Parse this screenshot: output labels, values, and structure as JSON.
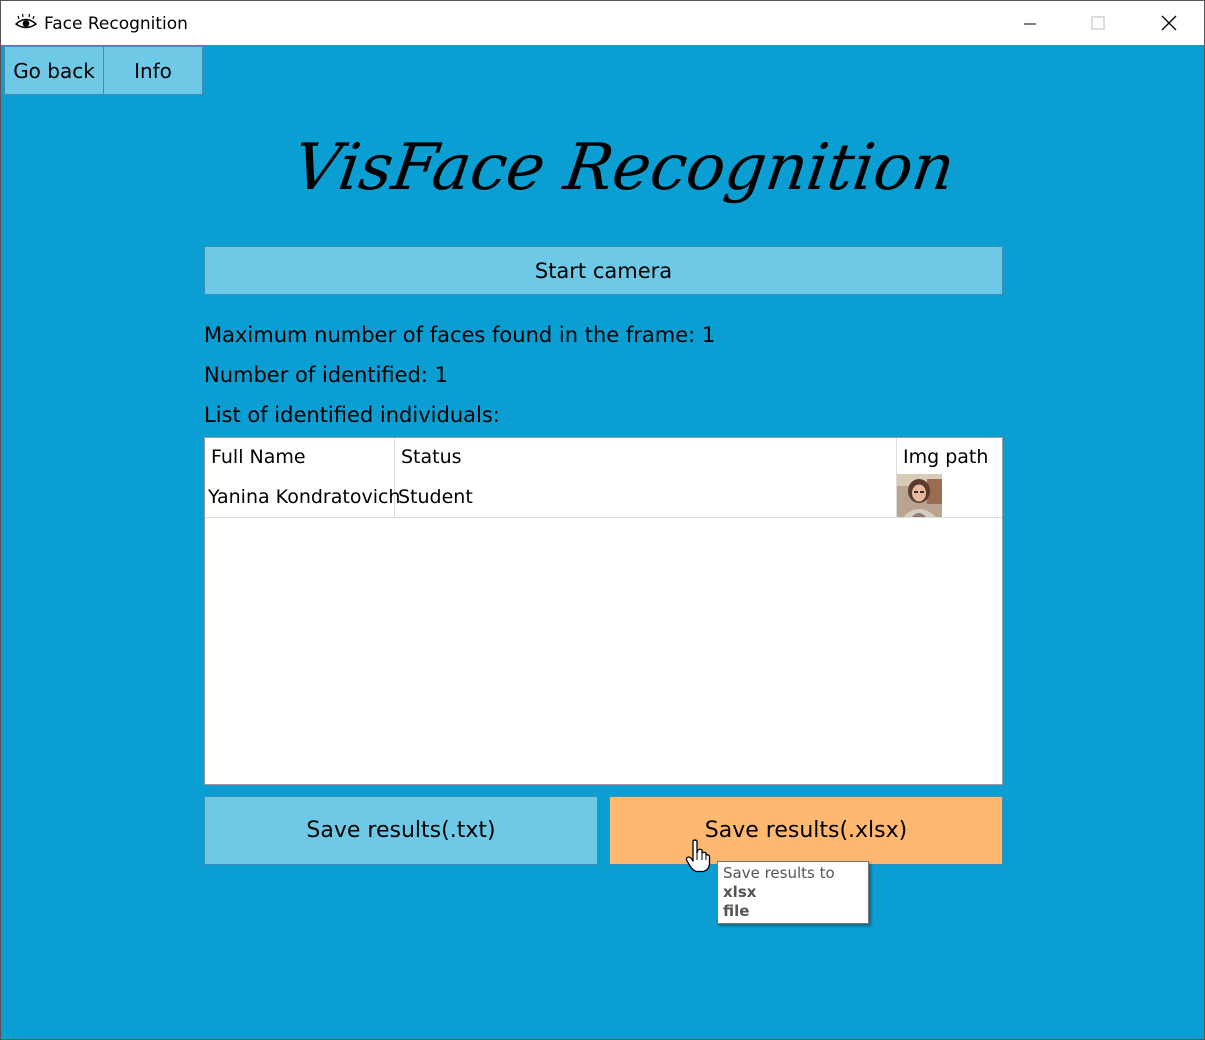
{
  "window": {
    "title": "Face Recognition",
    "icon": "eye-icon",
    "controls": [
      "minimize-icon",
      "maximize-icon",
      "close-icon"
    ]
  },
  "nav": {
    "go_back": "Go back",
    "info": "Info"
  },
  "brand": {
    "title": "VisFace Recognition"
  },
  "actions": {
    "start_camera": "Start camera",
    "save_txt": "Save results(.txt)",
    "save_xlsx": "Save results(.xlsx)"
  },
  "stats": {
    "max_faces": "Maximum number of faces found in the frame: 1",
    "identified": "Number of identified: 1",
    "list_heading": "List of identified individuals:"
  },
  "table": {
    "columns": [
      "Full Name",
      "Status",
      "Img path"
    ],
    "rows": [
      {
        "full_name": "Yanina Kondratovich",
        "status": "Student",
        "img": "person-photo"
      }
    ]
  },
  "tooltip": {
    "prefix": "Save results to ",
    "bold1": "xlsx",
    "bold2": "file"
  },
  "colors": {
    "background": "#0a9ed2",
    "button": "#6ec9e6",
    "button_hover": "#ffb870"
  }
}
